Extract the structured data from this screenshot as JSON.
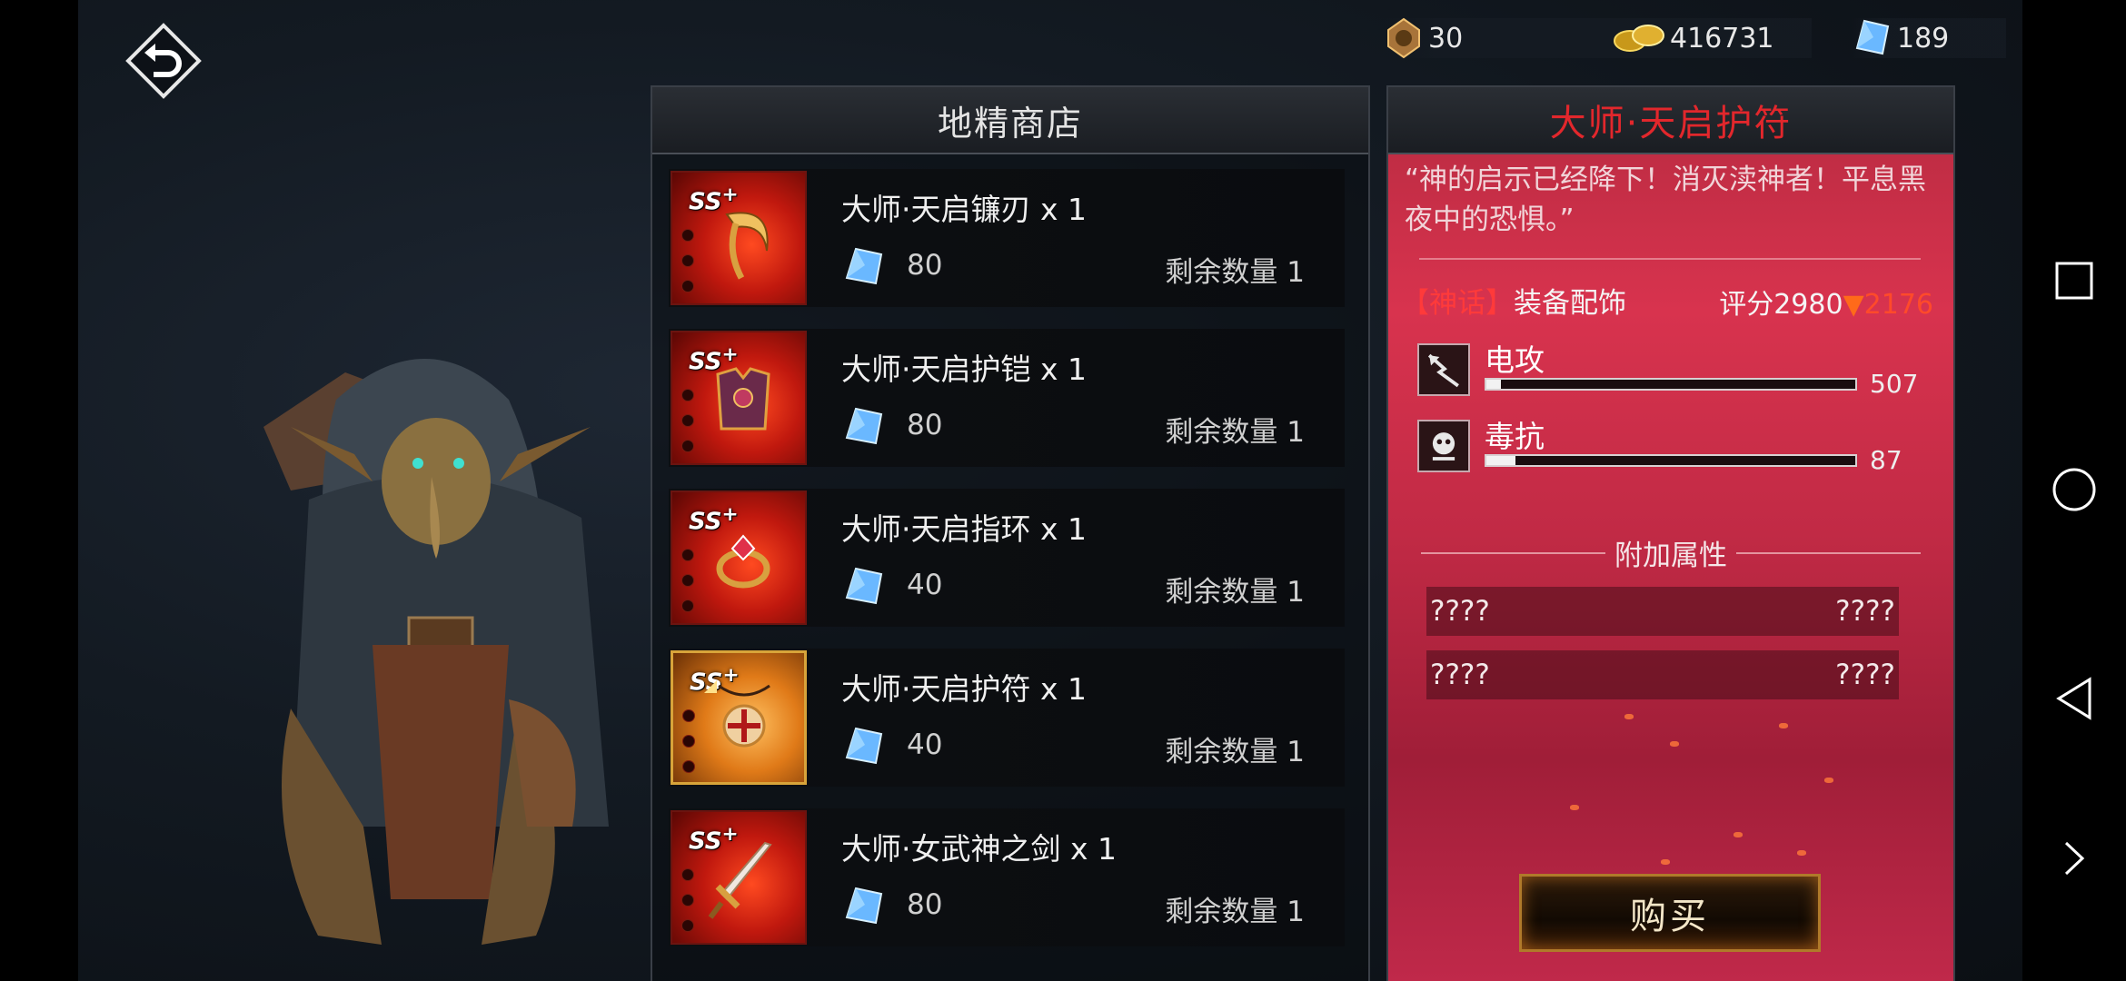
{
  "currencies": [
    {
      "icon": "medal-icon",
      "value": "30"
    },
    {
      "icon": "gold-coins-icon",
      "value": "416731"
    },
    {
      "icon": "crystal-icon",
      "value": "189"
    }
  ],
  "shop": {
    "title": "地精商店",
    "items": [
      {
        "badge": "SS",
        "icon": "scythe-icon",
        "name": "大师·天启镰刃 x 1",
        "price": "80",
        "stock": "剩余数量 1",
        "selected": false
      },
      {
        "badge": "SS",
        "icon": "armor-icon",
        "name": "大师·天启护铠 x 1",
        "price": "80",
        "stock": "剩余数量 1",
        "selected": false
      },
      {
        "badge": "SS",
        "icon": "ring-icon",
        "name": "大师·天启指环 x 1",
        "price": "40",
        "stock": "剩余数量 1",
        "selected": false
      },
      {
        "badge": "SS",
        "icon": "amulet-icon",
        "name": "大师·天启护符 x 1",
        "price": "40",
        "stock": "剩余数量 1",
        "selected": true
      },
      {
        "badge": "SS",
        "icon": "sword-icon",
        "name": "大师·女武神之剑 x 1",
        "price": "80",
        "stock": "剩余数量 1",
        "selected": false
      }
    ]
  },
  "detail": {
    "title": "大师·天启护符",
    "quote": "“神的启示已经降下！消灭渎神者！平息黑夜中的恐惧。”",
    "rarity": "【神话】",
    "category": "装备配饰",
    "score_label": "评分2980",
    "score_arrow": "▼",
    "score_old": "2176",
    "stats": [
      {
        "icon": "lightning-attack-icon",
        "label": "电攻",
        "value": "507",
        "fill": 0.04
      },
      {
        "icon": "skull-resist-icon",
        "label": "毒抗",
        "value": "87",
        "fill": 0.08
      }
    ],
    "extra_header": "附加属性",
    "extra_attrs": [
      {
        "left": "????",
        "right": "????"
      },
      {
        "left": "????",
        "right": "????"
      }
    ],
    "buy_label": "购买"
  },
  "colors": {
    "title_red": "#e2272c",
    "myth_red": "#ff3a3a",
    "panel_pink": "#d8334e",
    "gold_border": "#d8a43a"
  }
}
